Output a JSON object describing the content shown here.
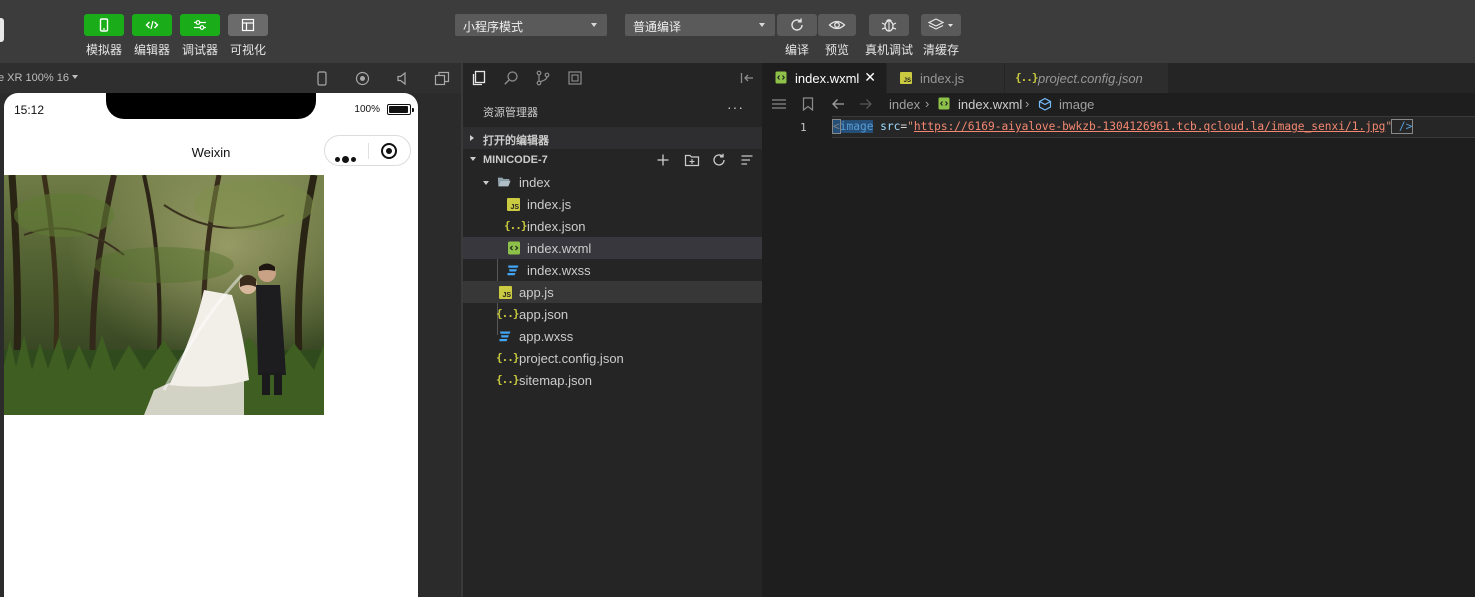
{
  "toolbar": {
    "buttons": [
      {
        "label": "模拟器",
        "icon": "phone-icon"
      },
      {
        "label": "编辑器",
        "icon": "code-icon"
      },
      {
        "label": "调试器",
        "icon": "sliders-icon"
      },
      {
        "label": "可视化",
        "icon": "layout-icon"
      }
    ],
    "mode_select": "小程序模式",
    "compile_select": "普通编译",
    "actions": [
      {
        "label": "编译",
        "icon": "refresh-icon"
      },
      {
        "label": "预览",
        "icon": "eye-icon"
      },
      {
        "label": "真机调试",
        "icon": "bug-icon"
      },
      {
        "label": "清缓存",
        "icon": "layers-icon"
      }
    ],
    "colors": {
      "active_button": "#1aad19",
      "inactive_button": "#6b6b6b"
    }
  },
  "simulator": {
    "device_label": "e XR 100% 16",
    "status": {
      "time": "15:12",
      "battery": "100%"
    },
    "nav_title": "Weixin"
  },
  "explorer": {
    "title": "资源管理器",
    "more": "···",
    "open_editors": "打开的编辑器",
    "project": "MINICODE-7",
    "tree": [
      {
        "name": "index",
        "type": "folder"
      },
      {
        "name": "index.js",
        "type": "js"
      },
      {
        "name": "index.json",
        "type": "json"
      },
      {
        "name": "index.wxml",
        "type": "wxml"
      },
      {
        "name": "index.wxss",
        "type": "wxss"
      },
      {
        "name": "app.js",
        "type": "js"
      },
      {
        "name": "app.json",
        "type": "json"
      },
      {
        "name": "app.wxss",
        "type": "wxss"
      },
      {
        "name": "project.config.json",
        "type": "json"
      },
      {
        "name": "sitemap.json",
        "type": "json"
      }
    ]
  },
  "editor": {
    "tabs": [
      {
        "name": "index.wxml",
        "active": true
      },
      {
        "name": "index.js",
        "active": false
      },
      {
        "name": "project.config.json",
        "active": false
      }
    ],
    "breadcrumb": [
      "index",
      "index.wxml",
      "image"
    ],
    "lines": [
      {
        "number": "1",
        "open": "<",
        "tag": "image",
        "attr": " src",
        "eq": "=",
        "quote_open": "\"",
        "url": "https://6169-aiyalove-bwkzb-1304126961.tcb.qcloud.la/image_senxi/1.jpg",
        "quote_close": "\"",
        "close": " />"
      }
    ]
  }
}
